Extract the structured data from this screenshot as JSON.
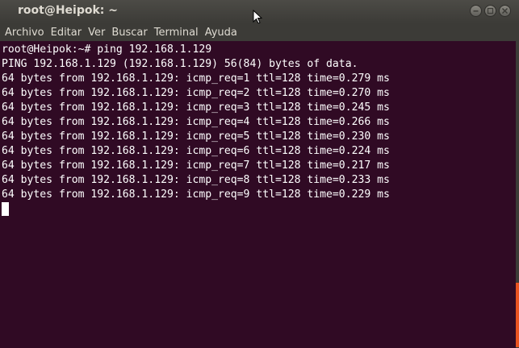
{
  "window": {
    "title": "root@Heipok: ~"
  },
  "menubar": {
    "items": [
      "Archivo",
      "Editar",
      "Ver",
      "Buscar",
      "Terminal",
      "Ayuda"
    ]
  },
  "terminal": {
    "lines": [
      "root@Heipok:~# ping 192.168.1.129",
      "PING 192.168.1.129 (192.168.1.129) 56(84) bytes of data.",
      "64 bytes from 192.168.1.129: icmp_req=1 ttl=128 time=0.279 ms",
      "64 bytes from 192.168.1.129: icmp_req=2 ttl=128 time=0.270 ms",
      "64 bytes from 192.168.1.129: icmp_req=3 ttl=128 time=0.245 ms",
      "64 bytes from 192.168.1.129: icmp_req=4 ttl=128 time=0.266 ms",
      "64 bytes from 192.168.1.129: icmp_req=5 ttl=128 time=0.230 ms",
      "64 bytes from 192.168.1.129: icmp_req=6 ttl=128 time=0.224 ms",
      "64 bytes from 192.168.1.129: icmp_req=7 ttl=128 time=0.217 ms",
      "64 bytes from 192.168.1.129: icmp_req=8 ttl=128 time=0.233 ms",
      "64 bytes from 192.168.1.129: icmp_req=9 ttl=128 time=0.229 ms"
    ]
  },
  "colors": {
    "terminal_bg": "#300a24",
    "titlebar_bg": "#3c3b37",
    "text": "#ffffff",
    "accent": "#e95420"
  },
  "icons": [
    "minimize-icon",
    "maximize-icon",
    "close-icon",
    "mouse-pointer-icon"
  ]
}
